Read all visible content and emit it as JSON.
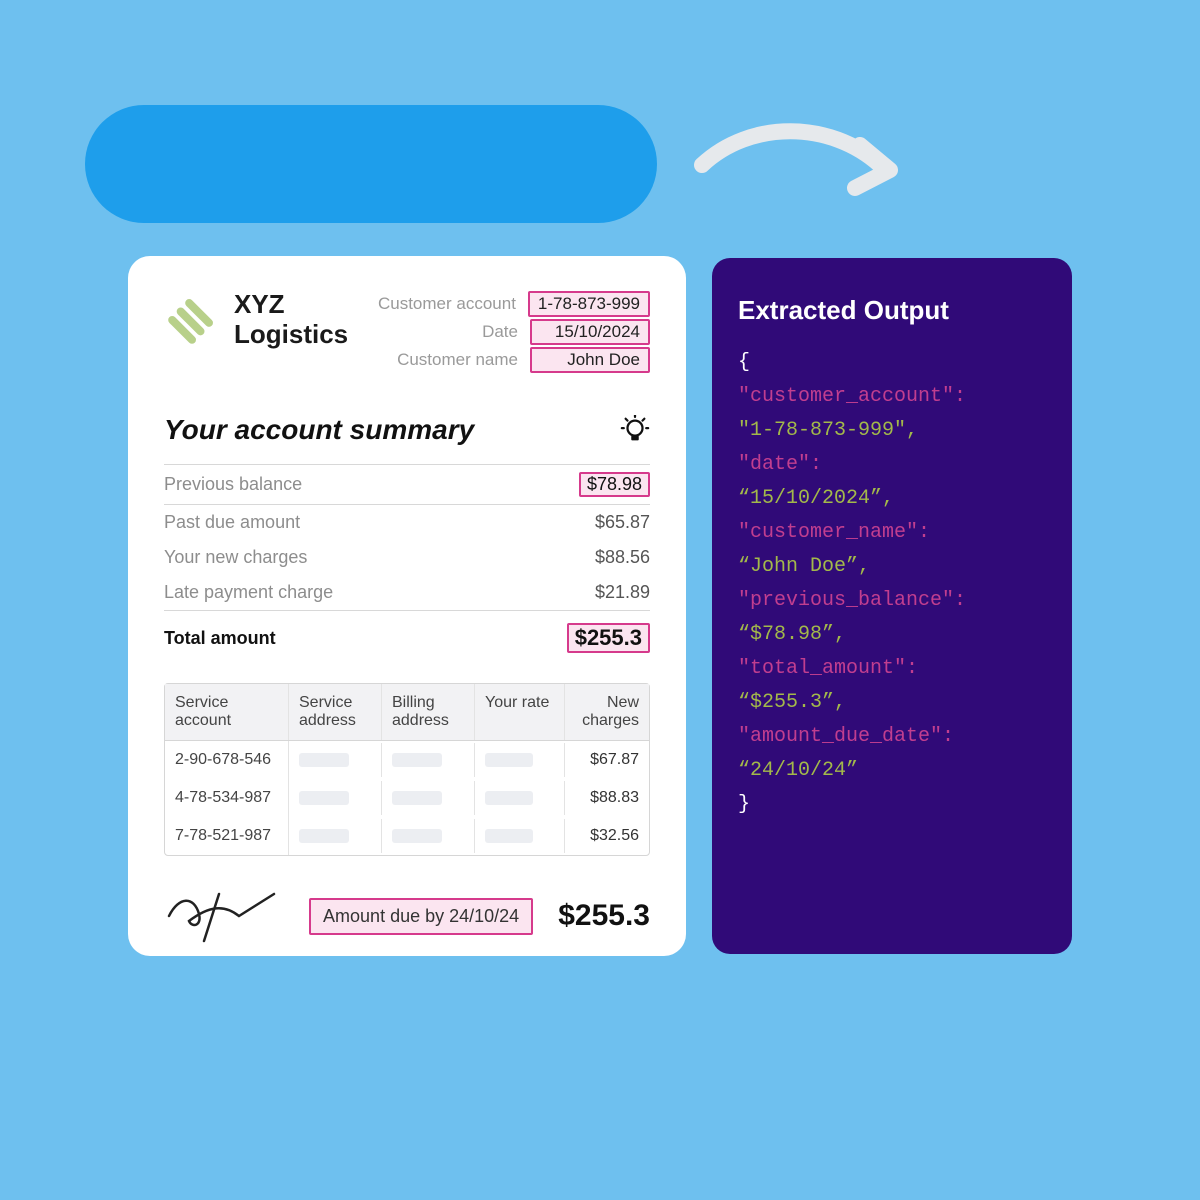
{
  "invoice": {
    "company_line1": "XYZ",
    "company_line2": "Logistics",
    "meta": {
      "account_label": "Customer account",
      "account_value": "1-78-873-999",
      "date_label": "Date",
      "date_value": "15/10/2024",
      "name_label": "Customer name",
      "name_value": "John Doe"
    },
    "summary_title": "Your account summary",
    "rows": {
      "prev_balance_label": "Previous balance",
      "prev_balance_value": "$78.98",
      "past_due_label": "Past due amount",
      "past_due_value": "$65.87",
      "new_charges_label": "Your new charges",
      "new_charges_value": "$88.56",
      "late_label": "Late payment charge",
      "late_value": "$21.89",
      "total_label": "Total amount",
      "total_value": "$255.3"
    },
    "table": {
      "headers": {
        "c1": "Service account",
        "c2": "Service address",
        "c3": "Billing address",
        "c4": "Your rate",
        "c5": "New charges"
      },
      "rows": [
        {
          "acct": "2-90-678-546",
          "charge": "$67.87"
        },
        {
          "acct": "4-78-534-987",
          "charge": "$88.83"
        },
        {
          "acct": "7-78-521-987",
          "charge": "$32.56"
        }
      ]
    },
    "due_text": "Amount due by 24/10/24",
    "footer_total": "$255.3"
  },
  "panel": {
    "title": "Extracted Output",
    "json": {
      "k1": "\"customer_account\":",
      "v1": "\"1-78-873-999\",",
      "k2": "\"date\":",
      "v2": "“15/10/2024”,",
      "k3": "\"customer_name\":",
      "v3": "“John Doe”,",
      "k4": "\"previous_balance\":",
      "v4": "“$78.98”,",
      "k5": "\"total_amount\":",
      "v5": "“$255.3”,",
      "k6": "\"amount_due_date\":",
      "v6": "“24/10/24”"
    }
  }
}
